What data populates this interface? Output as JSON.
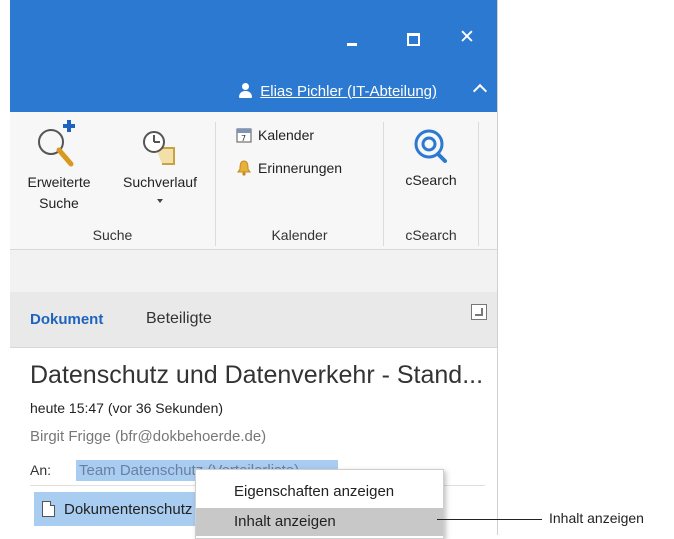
{
  "window": {
    "user_name": "Elias Pichler (IT-Abteilung)",
    "close_glyph": "✕"
  },
  "ribbon": {
    "search_group": {
      "label": "Suche",
      "advanced_search": {
        "line1": "Erweiterte",
        "line2": "Suche",
        "icon": "magnifier-plus-icon"
      },
      "search_history": {
        "label": "Suchverlauf",
        "icon": "history-clock-icon"
      }
    },
    "calendar_group": {
      "label": "Kalender",
      "calendar": {
        "label": "Kalender",
        "icon": "calendar-icon"
      },
      "reminders": {
        "label": "Erinnerungen",
        "icon": "bell-icon"
      }
    },
    "csearch_group": {
      "label": "cSearch",
      "csearch": {
        "label": "cSearch",
        "icon": "csearch-icon"
      }
    }
  },
  "tabs": [
    {
      "label": "Dokument",
      "active": true
    },
    {
      "label": "Beteiligte",
      "active": false
    }
  ],
  "document": {
    "subject": "Datenschutz und Datenverkehr - Stand...",
    "date": "heute 15:47 (vor 36 Sekunden)",
    "sender": "Birgit Frigge (bfr@dokbehoerde.de)",
    "to_label": "An:",
    "recipient": "Team Datenschutz (Verteilerliste)",
    "attachment": "Dokumentenschutz"
  },
  "context_menu": {
    "items": [
      {
        "label": "Eigenschaften anzeigen",
        "highlighted": false
      },
      {
        "label": "Inhalt anzeigen",
        "highlighted": true
      }
    ]
  },
  "callout": {
    "text": "Inhalt anzeigen"
  },
  "colors": {
    "titlebar": "#2b79d0",
    "accent": "#1e64bf",
    "selection": "#a9cdf0",
    "menu_highlight": "#c8c8c8"
  }
}
